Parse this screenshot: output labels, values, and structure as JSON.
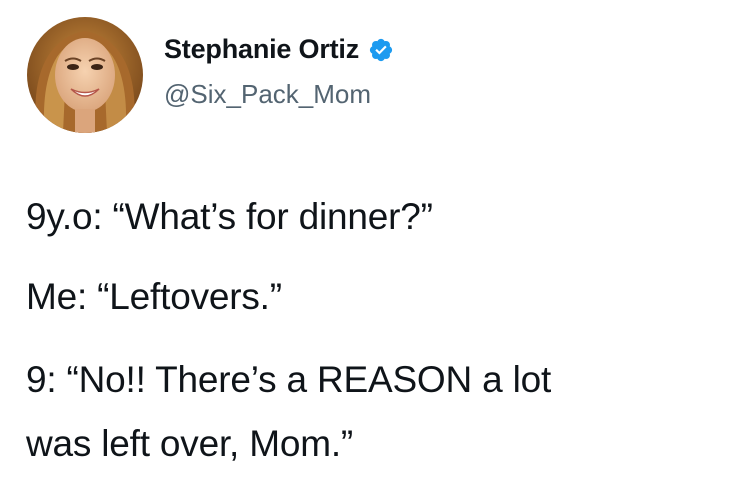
{
  "author": {
    "display_name": "Stephanie Ortiz",
    "handle": "@Six_Pack_Mom",
    "verified_badge_icon": "verified-check-icon",
    "verified_color": "#1d9bf0"
  },
  "tweet": {
    "lines": [
      "9y.o: “What’s for dinner?”",
      "Me: “Leftovers.”",
      "9: “No!! There’s a REASON a lot",
      "was left over, Mom.”"
    ]
  }
}
